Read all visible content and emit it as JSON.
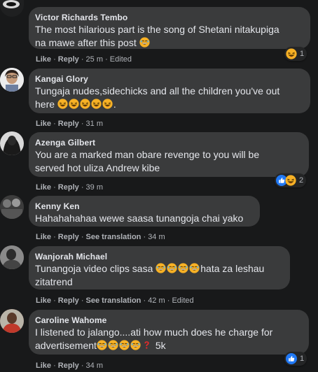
{
  "comments": [
    {
      "name": "Victor Richards Tembo",
      "line1": "The most hilarious part is the song of Shetani nitakupiga",
      "line2": "na mawe after this post",
      "like": "Like",
      "reply": "Reply",
      "time": "25 m",
      "edited": "Edited",
      "reactions": "1"
    },
    {
      "name": "Kangai Glory",
      "line1": "Tungaja nudes,sidechicks and all the children you've out",
      "line2": "here",
      "line2_end": ".",
      "like": "Like",
      "reply": "Reply",
      "time": "31 m"
    },
    {
      "name": "Azenga Gilbert",
      "line1": "You are a marked man obare revenge to you will be",
      "line2": "served hot uliza Andrew kibe",
      "like": "Like",
      "reply": "Reply",
      "time": "39 m",
      "reactions": "2"
    },
    {
      "name": "Kenny Ken",
      "line1": "Hahahahahaa wewe saasa tunangoja chai yako",
      "like": "Like",
      "reply": "Reply",
      "translate": "See translation",
      "time": "34 m"
    },
    {
      "name": "Wanjorah Michael",
      "line1_start": "Tunangoja video clips sasa",
      "line1_end": "hata za leshau",
      "line2": "zitatrend",
      "like": "Like",
      "reply": "Reply",
      "translate": "See translation",
      "time": "42 m",
      "edited": "Edited"
    },
    {
      "name": "Caroline Wahome",
      "line1": "I listened to jalango....ati how much does he charge for",
      "line2": "advertisement",
      "line2_end": "5k",
      "like": "Like",
      "reply": "Reply",
      "time": "34 m",
      "reactions": "1"
    }
  ],
  "colors": {
    "background": "#18191a",
    "bubble": "#3a3b3c",
    "meta": "#b0b3b8",
    "like_blue": "#2078f4",
    "haha_yellow": "#f7b125"
  }
}
